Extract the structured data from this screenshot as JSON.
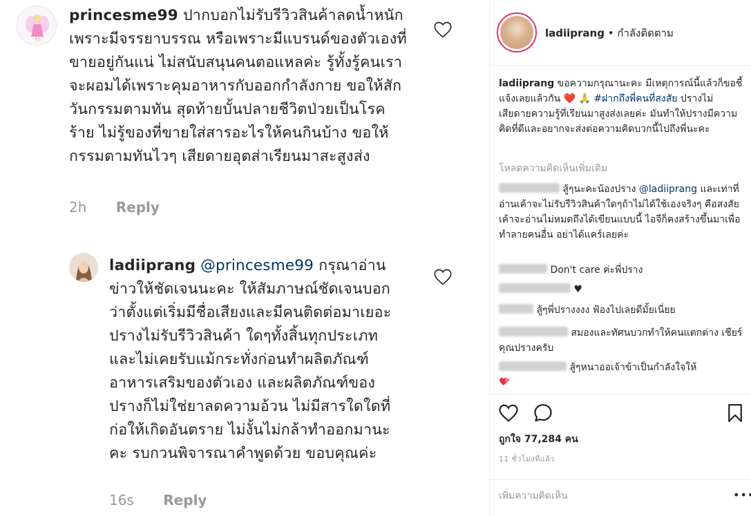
{
  "left_comments": [
    {
      "user": "princesme99",
      "text": "ปากบอกไม่รับรีวิวสินค้าลดน้ำหนัก เพราะมีจรรยาบรรณ หรือเพราะมีแบรนด์ของตัวเองที่ขายอยู่กันแน่ ไม่สนับสนุนคนตอแหลค่ะ รู้ทั้งรู้คนเราจะผอมได้เพราะคุมอาหารกับออกกำลังกาย ขอให้สักวันกรรมตามทัน สุดท้ายบั้นปลายชีวิตป่วยเป็นโรคร้าย ไม่รู้ของที่ขายใส่สารอะไรให้คนกินบ้าง ขอให้กรรมตามทันไวๆ เสียดายอุตส่าเรียนมาสะสูงส่ง",
      "time": "2h",
      "reply": "Reply"
    },
    {
      "user": "ladiiprang",
      "mention": "@princesme99",
      "text": "กรุณาอ่านข่าวให้ชัดเจนนะคะ ให้สัมภาษณ์ชัดเจนบอกว่าตั้งแต่เริ่มมีชื่อเสียงและมีคนติดต่อมาเยอะ ปรางไม่รับรีวิวสินค้า ใดๆทั้งสิ้นทุกประเภท และไม่เคยรับแม้กระทั่งก่อนทำผลิตภัณฑ์อาหารเสริมของตัวเอง และผลิตภัณฑ์ของปรางก็ไม่ใช่ยาลดความอ้วน ไม่มีสารใดใดที่ก่อให้เกิดอันตราย ไม่งั้นไม่กล้าทำออกมานะคะ รบกวนพิจารณาคำพูดด้วย ขอบคุณค่ะ",
      "time": "16s",
      "reply": "Reply"
    }
  ],
  "header": {
    "username": "ladiiprang",
    "separator": " • ",
    "follow_status": "กำลังติดตาม"
  },
  "post": {
    "username": "ladiiprang",
    "text_a": " ขอความกรุณานะคะ มีเหตุการณ์นี้แล้วก็ขอชี้แจ้งเลยแล้วกัน ",
    "emoji_heart": "❤️",
    "emoji_pray": "🙏",
    "hashtag": "#ฝากถึงพี่คนที่สงสัย",
    "text_b": " ปรางไม่เสียดายความรู้ที่เรียนมาสูงส่งเลยค่ะ มันทำให้ปรางมีความคิดที่ดีและอยากจะส่งต่อความคิดบวกนี้ไปถึงพี่นะคะ"
  },
  "load_more": "โหลดความคิดเห็นเพิ่มเติม",
  "comments": [
    {
      "user_visible": "",
      "text": "สู้ๆนะคะน้องปราง ",
      "mention": "@ladiiprang",
      "text2": " และเท่าที่อ่านเค้าจะไม่รับรีวิวสินค้าใดๆถ้าไม่ได้ใช้เองจริงๆ คือสงสัยเค้าจะอ่านไม่หมดถึงได้เขียนแบบนี้ ไอจีก็คงสร้างขึ้นมาเพื่อทำลายคนอื่น อย่าได้แคร์เลยค่ะ"
    },
    {
      "text": "Don't care ค่ะพี่ปราง"
    },
    {
      "text": "♥"
    },
    {
      "text": "สู้ๆพี่ปรางงงง ฟ้องไปเลยดีมั้ยเนี่ยย"
    },
    {
      "text": "สมองและทัศนบวกทำให้คนแตกต่าง เชียร์คุณปรางครับ"
    },
    {
      "text": "สู้ๆหนาออเจ้าข้าเป็นกำลังใจให้"
    }
  ],
  "actions": {
    "likes": "ถูกใจ 77,284 คน",
    "time": "11 ชั่วโมงที่แล้ว"
  },
  "add_comment_placeholder": "เพิ่มความคิดเห็น",
  "more_label": "•••"
}
